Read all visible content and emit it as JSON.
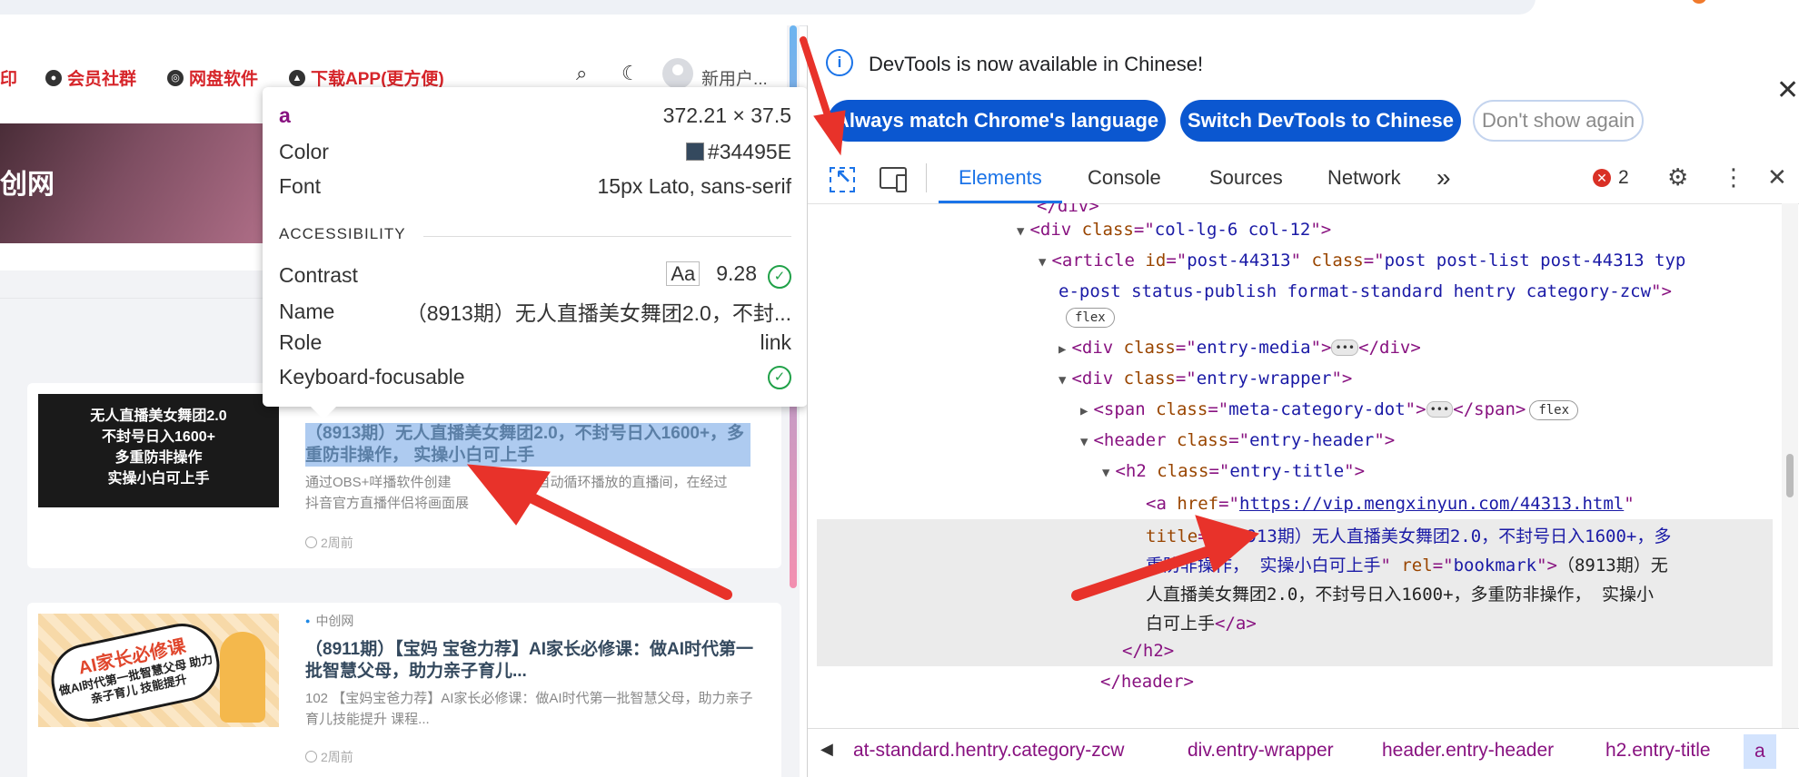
{
  "colors": {
    "brand_red": "#d6252a",
    "title_color": "#34495e",
    "devtools_blue": "#1a73e8",
    "tag_purple": "#881280"
  },
  "site": {
    "nav": [
      {
        "label": "印",
        "icon": ""
      },
      {
        "label": "会员社群",
        "icon": "wechat-icon"
      },
      {
        "label": "网盘软件",
        "icon": "disk-icon"
      },
      {
        "label": "下载APP(更方便)",
        "icon": "app-icon"
      }
    ],
    "user_name": "新用户...",
    "hero_title": "创网",
    "posts": [
      {
        "thumb_lines": [
          "无人直播美女舞团2.0",
          "不封号日入1600+",
          "多重防非操作",
          "实操小白可上手"
        ],
        "title": "（8913期）无人直播美女舞团2.0，不封号日入1600+，多重防非操作， 实操小白可上手",
        "excerpt": "通过OBS+咩播软件创建",
        "excerpt_tail": "小时自动循环播放的直播间，在经过",
        "excerpt_line2": "抖音官方直播伴侣将画面展",
        "time": "2周前"
      },
      {
        "category": "中创网",
        "thumb_badge_title": "AI家长必修课",
        "thumb_badge_sub": "做AI时代第一批智慧父母 助力亲子育儿 技能提升",
        "title": "（8911期）【宝妈 宝爸力荐】AI家长必修课：做AI时代第一批智慧父母，助力亲子育儿...",
        "excerpt": "102 【宝妈宝爸力荐】AI家长必修课：做AI时代第一批智慧父母，助力亲子育儿技能提升 课程...",
        "time": "2周前"
      }
    ]
  },
  "tooltip": {
    "tag": "a",
    "size": "372.21 × 37.5",
    "color_label": "Color",
    "color_value": "#34495E",
    "font_label": "Font",
    "font_value": "15px Lato, sans-serif",
    "section": "ACCESSIBILITY",
    "contrast_label": "Contrast",
    "contrast_aa": "Aa",
    "contrast_value": "9.28",
    "name_label": "Name",
    "name_value": "（8913期）无人直播美女舞团2.0，不封...",
    "role_label": "Role",
    "role_value": "link",
    "kbd_label": "Keyboard-focusable"
  },
  "devtools": {
    "banner_text": "DevTools is now available in Chinese!",
    "btn_always": "Always match Chrome's language",
    "btn_switch": "Switch DevTools to Chinese",
    "btn_dont": "Don't show again",
    "tabs": [
      "Elements",
      "Console",
      "Sources",
      "Network"
    ],
    "more_tabs": "»",
    "error_count": "2",
    "dom": {
      "l0": "</div>",
      "l1_tag": "div",
      "l1_attr": "class",
      "l1_val": "col-lg-6 col-12",
      "l2_tag": "article",
      "l2_id_val": "post-44313",
      "l2_class_val": "post post-list post-44313 typ",
      "l2b": "e-post status-publish format-standard hentry category-zcw",
      "flex": "flex",
      "l3_val": "entry-media",
      "l4_val": "entry-wrapper",
      "l5_tag": "span",
      "l5_val": "meta-category-dot",
      "l6_tag": "header",
      "l6_val": "entry-header",
      "l7_tag": "h2",
      "l7_val": "entry-title",
      "href": "https://vip.mengxinyun.com/44313.html",
      "title_val_1": "（8913期）无人直播美女舞团2.0，不封号日入1600+，多",
      "title_val_2": "重防非操作， 实操小白可上手",
      "rel_val": "bookmark",
      "text_1": "（8913期）无",
      "text_2": "人直播美女舞团2.0，不封号日入1600+，多重防非操作， 实操小",
      "text_3": "白可上手",
      "close_h2": "</h2>",
      "close_header": "</header>"
    },
    "breadcrumbs": [
      "at-standard.hentry.category-zcw",
      "div.entry-wrapper",
      "header.entry-header",
      "h2.entry-title",
      "a"
    ]
  }
}
